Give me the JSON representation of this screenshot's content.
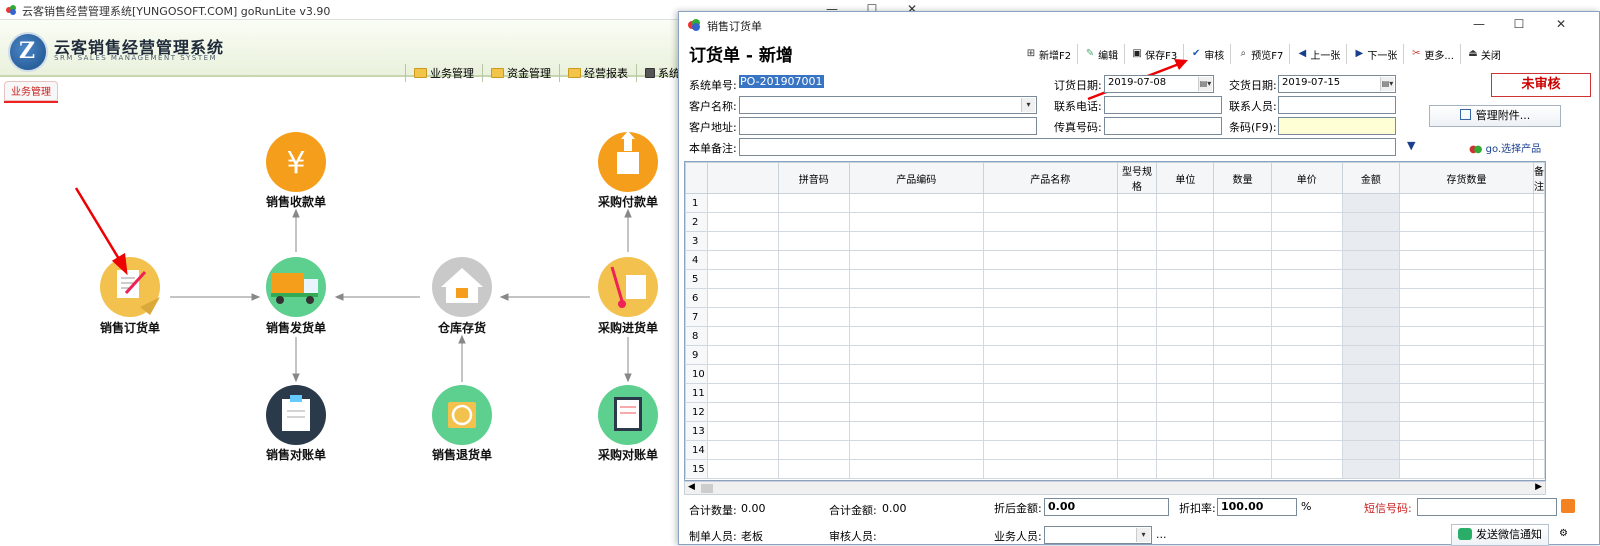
{
  "main": {
    "title": "云客销售经营管理系统[YUNGOSOFT.COM]  goRunLite v3.90",
    "brand": "云客销售经营管理系统",
    "brand_sub": "SRM SALES MANAGEMENT SYSTEM",
    "logo_letter": "Z",
    "menu": [
      "业务管理",
      "资金管理",
      "经营报表",
      "系统管"
    ],
    "active_tab": "业务管理",
    "nodes": {
      "sales_receipt": "销售收款单",
      "purchase_payment": "采购付款单",
      "sales_order": "销售订货单",
      "sales_delivery": "销售发货单",
      "warehouse": "仓库存货",
      "purchase_in": "采购进货单",
      "sales_statement": "销售对账单",
      "sales_return": "销售退货单",
      "purchase_statement": "采购对账单"
    },
    "yen_symbol": "¥"
  },
  "dialog": {
    "title": "销售订货单",
    "heading": "订货单 - 新增",
    "toolbar": [
      "新增F2",
      "编辑",
      "保存F3",
      "审核",
      "预览F7",
      "上一张",
      "下一张",
      "更多...",
      "关闭"
    ],
    "form": {
      "sys_no_label": "系统单号:",
      "sys_no": "PO-201907001",
      "order_date_label": "订货日期:",
      "order_date": "2019-07-08",
      "delivery_date_label": "交货日期:",
      "delivery_date": "2019-07-15",
      "customer_label": "客户名称:",
      "phone_label": "联系电话:",
      "contact_label": "联系人员:",
      "address_label": "客户地址:",
      "fax_label": "传真号码:",
      "barcode_label": "条码(F9):",
      "remark_label": "本单备注:"
    },
    "status": "未审核",
    "attach_button": "管理附件...",
    "pick_product": "go.选择产品",
    "columns": [
      "拼音码",
      "产品编码",
      "产品名称",
      "型号规格",
      "单位",
      "数量",
      "单价",
      "金额",
      "存货数量",
      "备注"
    ],
    "rows": [
      "1",
      "2",
      "3",
      "4",
      "5",
      "6",
      "7",
      "8",
      "9",
      "10",
      "11",
      "12",
      "13",
      "14",
      "15"
    ],
    "footer": {
      "total_qty_label": "合计数量:",
      "total_qty": "0.00",
      "total_amt_label": "合计金额:",
      "total_amt": "0.00",
      "disc_amt_label": "折后金额:",
      "disc_amt": "0.00",
      "disc_rate_label": "折扣率:",
      "disc_rate": "100.00",
      "percent": "%",
      "sms_label": "短信号码:",
      "maker_label": "制单人员:",
      "maker": "老板",
      "auditor_label": "审核人员:",
      "sales_label": "业务人员:",
      "ellipsis": "...",
      "wechat_button": "发送微信通知"
    }
  },
  "colors": {
    "accent_red": "#d22",
    "orange": "#f59e1b",
    "green": "#5dcf8e",
    "dark": "#2a3a4a",
    "gray": "#c9c9c9"
  }
}
